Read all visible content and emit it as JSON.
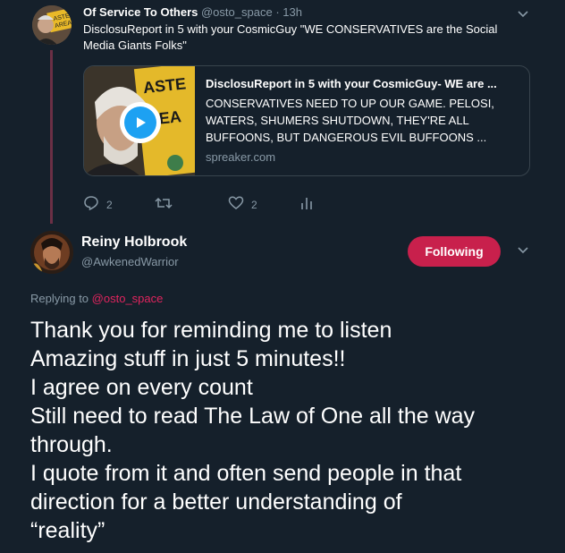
{
  "parent_tweet": {
    "name": "Of Service To Others",
    "handle": "@osto_space",
    "separator": "·",
    "time": "13h",
    "text": "DisclosuReport in 5 with your CosmicGuy \"WE CONSERVATIVES are the Social Media Giants Folks\"",
    "card": {
      "title": "DisclosuReport in 5 with your CosmicGuy- WE are ...",
      "description": "CONSERVATIVES NEED TO UP OUR GAME. PELOSI, WATERS, SHUMERS SHUTDOWN, THEY'RE ALL BUFFOONS, BUT DANGEROUS EVIL BUFFOONS ...",
      "domain": "spreaker.com"
    },
    "actions": {
      "reply_count": "2",
      "like_count": "2"
    }
  },
  "main_tweet": {
    "name": "Reiny Holbrook",
    "handle": "@AwkenedWarrior",
    "follow_label": "Following",
    "replying_prefix": "Replying to",
    "replying_handle": "@osto_space",
    "lines": [
      "Thank you for reminding me to listen",
      "Amazing stuff in just 5 minutes!!",
      "I agree on every count",
      "Still need to read The Law of One all the way",
      "through.",
      "I quote from it and often send people in that",
      "direction for a better understanding of",
      "“reality”"
    ]
  },
  "colors": {
    "background": "#15202b",
    "muted": "#8899a6",
    "accent": "#c8204c",
    "link": "#e0245e",
    "thread_line": "#6b2f45"
  },
  "icons": {
    "chevron": "chevron-down-icon",
    "reply": "reply-icon",
    "retweet": "retweet-icon",
    "like": "heart-icon",
    "analytics": "analytics-icon",
    "play": "play-icon"
  }
}
